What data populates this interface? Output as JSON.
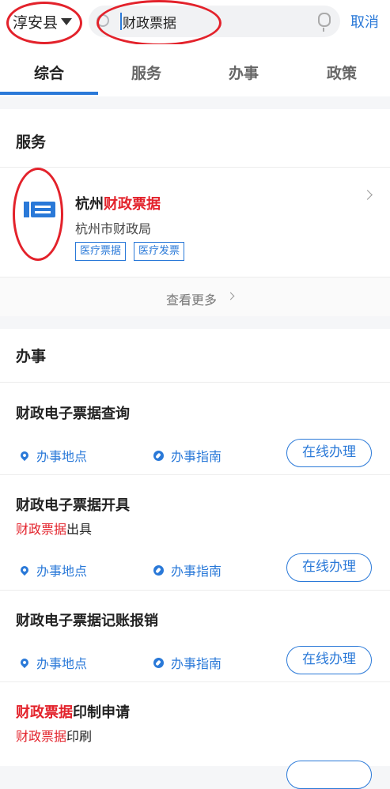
{
  "header": {
    "region": "淳安县",
    "search_value": "财政票据",
    "cancel": "取消"
  },
  "tabs": [
    "综合",
    "服务",
    "办事",
    "政策"
  ],
  "services": {
    "title": "服务",
    "item": {
      "name_prefix": "杭州",
      "name_highlight": "财政票据",
      "org": "杭州市财政局",
      "tags": [
        "医疗票据",
        "医疗发票"
      ]
    },
    "more": "查看更多"
  },
  "affairs": {
    "title": "办事",
    "location_label": "办事地点",
    "guide_label": "办事指南",
    "action_label": "在线办理",
    "items": [
      {
        "title": "财政电子票据查询"
      },
      {
        "title": "财政电子票据开具",
        "sub_highlight": "财政票据",
        "sub_rest": "出具"
      },
      {
        "title": "财政电子票据记账报销"
      },
      {
        "title_highlight": "财政票据",
        "title_rest": "印制申请",
        "sub_highlight": "财政票据",
        "sub_rest": "印刷"
      }
    ]
  },
  "colors": {
    "accent": "#2a79d8",
    "highlight": "#e3222b"
  }
}
